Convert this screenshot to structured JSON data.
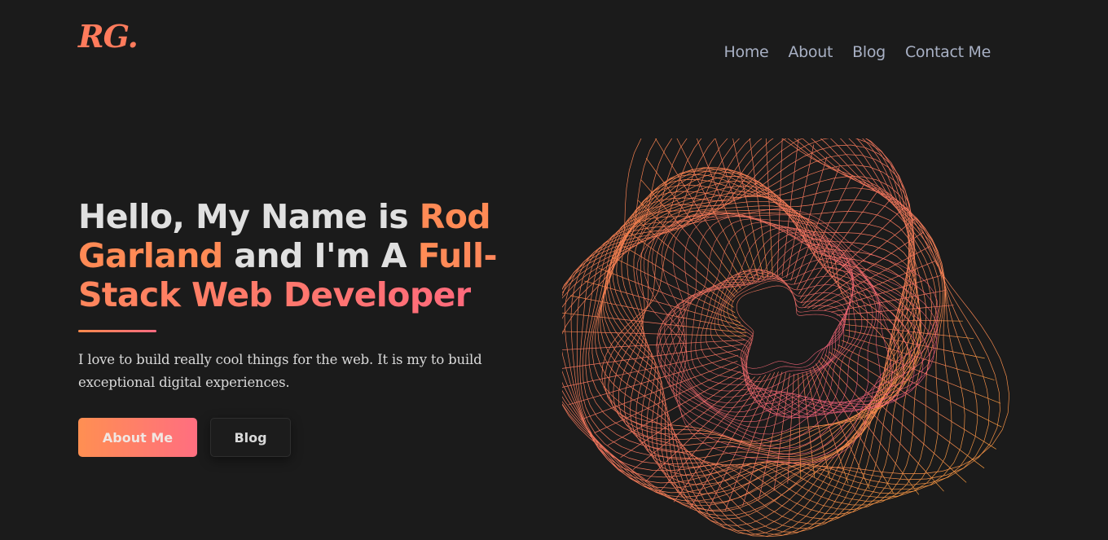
{
  "header": {
    "logo_text": "RG.",
    "nav": [
      {
        "label": "Home"
      },
      {
        "label": "About"
      },
      {
        "label": "Blog"
      },
      {
        "label": "Contact Me"
      }
    ]
  },
  "hero": {
    "heading": {
      "part1": "Hello, My Name is ",
      "name": "Rod Garland",
      "part2": " and I'm A ",
      "role": "Full-Stack Web Developer"
    },
    "intro": "I love to build really cool things for the web. It is my to build exceptional digital experiences.",
    "primary_button": "About Me",
    "secondary_button": "Blog"
  },
  "colors": {
    "background": "#1b1b1b",
    "accent_orange": "#ff8a55",
    "accent_pink": "#ff6a7c",
    "nav_text": "#a8b0c4"
  }
}
